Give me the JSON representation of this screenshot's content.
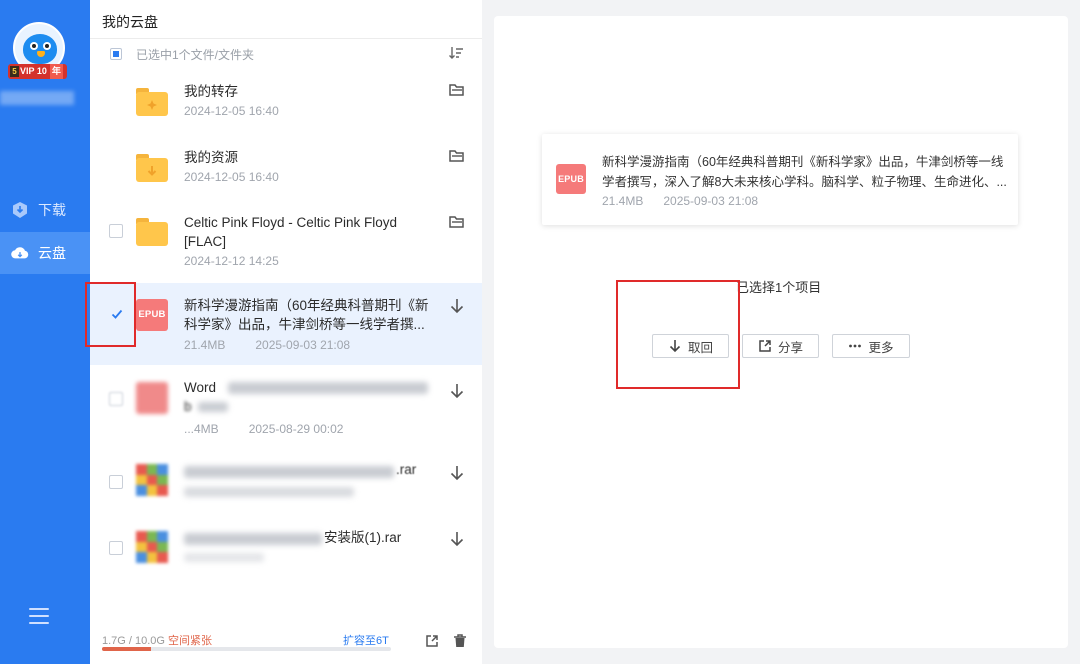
{
  "sidebar": {
    "vip_label": "VIP 10",
    "vip_year": "年",
    "items": [
      {
        "label": "下载",
        "icon": "download-shield-icon"
      },
      {
        "label": "云盘",
        "icon": "cloud-icon"
      }
    ],
    "active": "云盘",
    "menu_icon": "hamburger-menu-icon",
    "colors": {
      "bg": "#2a7bf0",
      "active": "#4a92f5"
    }
  },
  "panel": {
    "title": "我的云盘",
    "selection_text": "已选中1个文件/文件夹",
    "sort_icon": "sort-icon",
    "files": [
      {
        "name": "我的转存",
        "date": "2024-12-05 16:40",
        "type": "folder",
        "action_icon": "folder-open-icon"
      },
      {
        "name": "我的资源",
        "date": "2024-12-05 16:40",
        "type": "folder",
        "action_icon": "folder-open-icon"
      },
      {
        "name": "Celtic Pink Floyd - Celtic Pink Floyd [FLAC]",
        "date": "2024-12-12 14:25",
        "type": "folder",
        "action_icon": "folder-open-icon"
      },
      {
        "name": "新科学漫游指南（60年经典科普期刊《新科学家》出品，牛津剑桥等一线学者撰...",
        "size": "21.4MB",
        "date": "2025-09-03 21:08",
        "type": "epub",
        "thumb_label": "EPUB",
        "selected": true,
        "action_icon": "download-arrow-icon"
      },
      {
        "name": "Word",
        "name_tail": "b",
        "size": "...4MB",
        "date": "2025-08-29 00:02",
        "type": "blurred",
        "action_icon": "download-arrow-icon"
      },
      {
        "name": ".rar",
        "type": "blurred-archive",
        "action_icon": "download-arrow-icon"
      },
      {
        "name": "安装版(1).rar",
        "type": "blurred-archive",
        "action_icon": "download-arrow-icon"
      }
    ],
    "footer": {
      "usage": "1.7G / 10.0G",
      "warning": "空间紧张",
      "expand": "扩容至6T",
      "usage_fraction": 0.17,
      "export_icon": "export-icon",
      "trash_icon": "trash-icon"
    }
  },
  "detail": {
    "file": {
      "thumb_label": "EPUB",
      "name": "新科学漫游指南（60年经典科普期刊《新科学家》出品，牛津剑桥等一线学者撰写，深入了解8大未来核心学科。脑科学、粒子物理、生命进化、...",
      "size": "21.4MB",
      "date": "2025-09-03 21:08"
    },
    "selected_count": "已选择1个项目",
    "actions": [
      {
        "label": "取回",
        "icon": "download-arrow-icon"
      },
      {
        "label": "分享",
        "icon": "share-icon"
      },
      {
        "label": "更多",
        "icon": "more-dots-icon"
      }
    ]
  }
}
